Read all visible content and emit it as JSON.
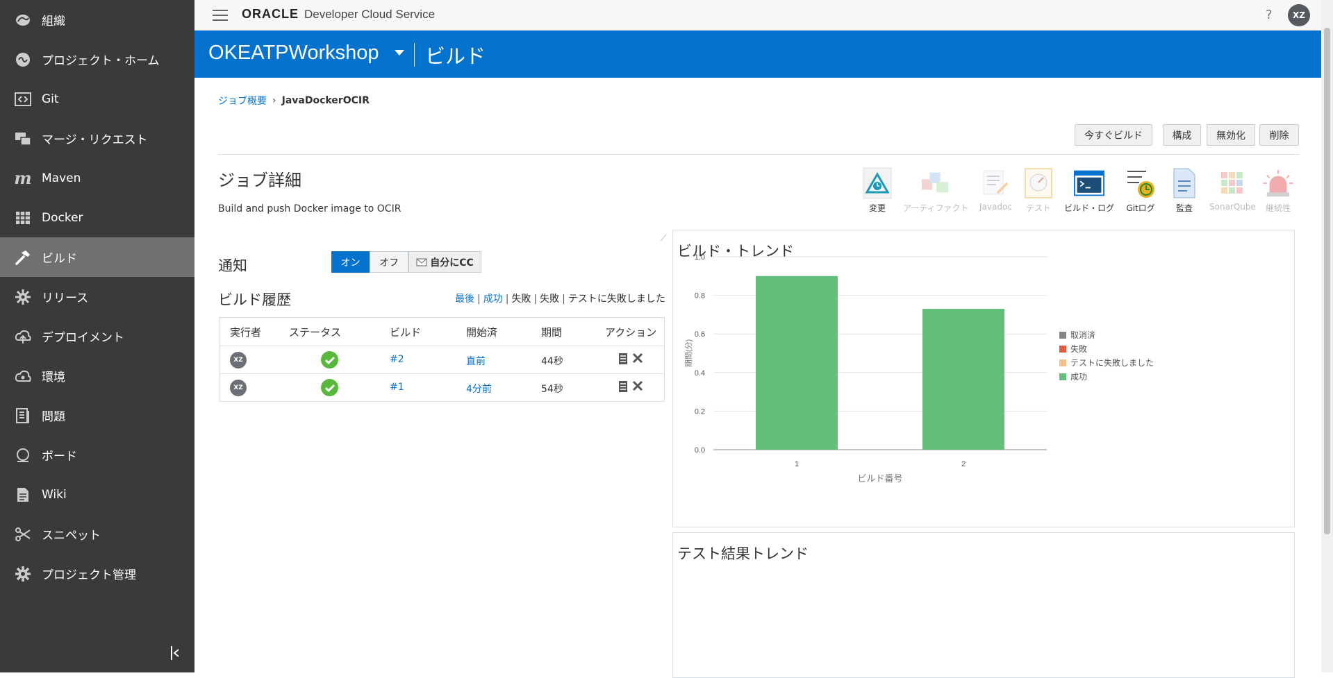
{
  "sidebar": {
    "items": [
      {
        "label": "組織",
        "icon": "organization-icon"
      },
      {
        "label": "プロジェクト・ホーム",
        "icon": "project-home-icon"
      },
      {
        "label": "Git",
        "icon": "git-icon"
      },
      {
        "label": "マージ・リクエスト",
        "icon": "merge-request-icon"
      },
      {
        "label": "Maven",
        "icon": "maven-icon"
      },
      {
        "label": "Docker",
        "icon": "docker-icon"
      },
      {
        "label": "ビルド",
        "icon": "build-hammer-icon",
        "active": true
      },
      {
        "label": "リリース",
        "icon": "release-icon"
      },
      {
        "label": "デプロイメント",
        "icon": "deployment-icon"
      },
      {
        "label": "環境",
        "icon": "environment-icon"
      },
      {
        "label": "問題",
        "icon": "issues-icon"
      },
      {
        "label": "ボード",
        "icon": "board-icon"
      },
      {
        "label": "Wiki",
        "icon": "wiki-icon"
      },
      {
        "label": "スニペット",
        "icon": "snippets-icon"
      },
      {
        "label": "プロジェクト管理",
        "icon": "project-admin-gear-icon"
      }
    ]
  },
  "topbar": {
    "brand_oracle": "ORACLE",
    "brand_service": "Developer Cloud Service",
    "help": "?",
    "user_initials": "XZ"
  },
  "project": {
    "name": "OKEATPWorkshop",
    "section": "ビルド"
  },
  "breadcrumb": {
    "parent": "ジョブ概要",
    "current": "JavaDockerOCIR"
  },
  "actions": {
    "build_now": "今すぐビルド",
    "configure": "構成",
    "disable": "無効化",
    "delete": "削除"
  },
  "job": {
    "title": "ジョブ詳細",
    "description": "Build and push Docker image to OCIR"
  },
  "toolbar": [
    {
      "label": "変更",
      "enabled": true
    },
    {
      "label": "アーティファクト",
      "enabled": false
    },
    {
      "label": "Javadoc",
      "enabled": false
    },
    {
      "label": "テスト",
      "enabled": false
    },
    {
      "label": "ビルド・ログ",
      "enabled": true
    },
    {
      "label": "Gitログ",
      "enabled": true
    },
    {
      "label": "監査",
      "enabled": true
    },
    {
      "label": "SonarQube",
      "enabled": false
    },
    {
      "label": "継続性",
      "enabled": false
    }
  ],
  "notification": {
    "label": "通知",
    "on": "オン",
    "off": "オフ",
    "cc": "自分にCC",
    "state": "on"
  },
  "history": {
    "title": "ビルド履歴",
    "filters": [
      "最後",
      "成功",
      "失敗",
      "失敗",
      "テストに失敗しました"
    ],
    "columns": [
      "実行者",
      "ステータス",
      "ビルド",
      "開始済",
      "期間",
      "アクション"
    ],
    "rows": [
      {
        "user": "XZ",
        "status": "success",
        "build": "#2",
        "started": "直前",
        "duration": "44秒"
      },
      {
        "user": "XZ",
        "status": "success",
        "build": "#1",
        "started": "4分前",
        "duration": "54秒"
      }
    ]
  },
  "trend_panel": {
    "title": "ビルド・トレンド"
  },
  "test_panel": {
    "title": "テスト結果トレンド"
  },
  "colors": {
    "brand_blue": "#0572ce",
    "sidebar_bg": "#3a3a3b",
    "sidebar_active": "#707070",
    "success_green": "#63c07c",
    "aborted_gray": "#848484",
    "failed_red": "#e15b40",
    "test_failed_orange": "#f5be8d"
  },
  "chart_data": {
    "type": "bar",
    "title": "ビルド・トレンド",
    "xlabel": "ビルド番号",
    "ylabel": "期間(分)",
    "categories": [
      "1",
      "2"
    ],
    "yticks": [
      "0.0",
      "0.2",
      "0.4",
      "0.6",
      "0.8",
      "1.0"
    ],
    "ylim": [
      0,
      1.0
    ],
    "grid": true,
    "legend_position": "right",
    "series": [
      {
        "name": "取消済",
        "color": "#848484",
        "values": [
          0,
          0
        ]
      },
      {
        "name": "失敗",
        "color": "#e15b40",
        "values": [
          0,
          0
        ]
      },
      {
        "name": "テストに失敗しました",
        "color": "#f5be8d",
        "values": [
          0,
          0
        ]
      },
      {
        "name": "成功",
        "color": "#63c07c",
        "values": [
          0.9,
          0.73
        ]
      }
    ]
  }
}
